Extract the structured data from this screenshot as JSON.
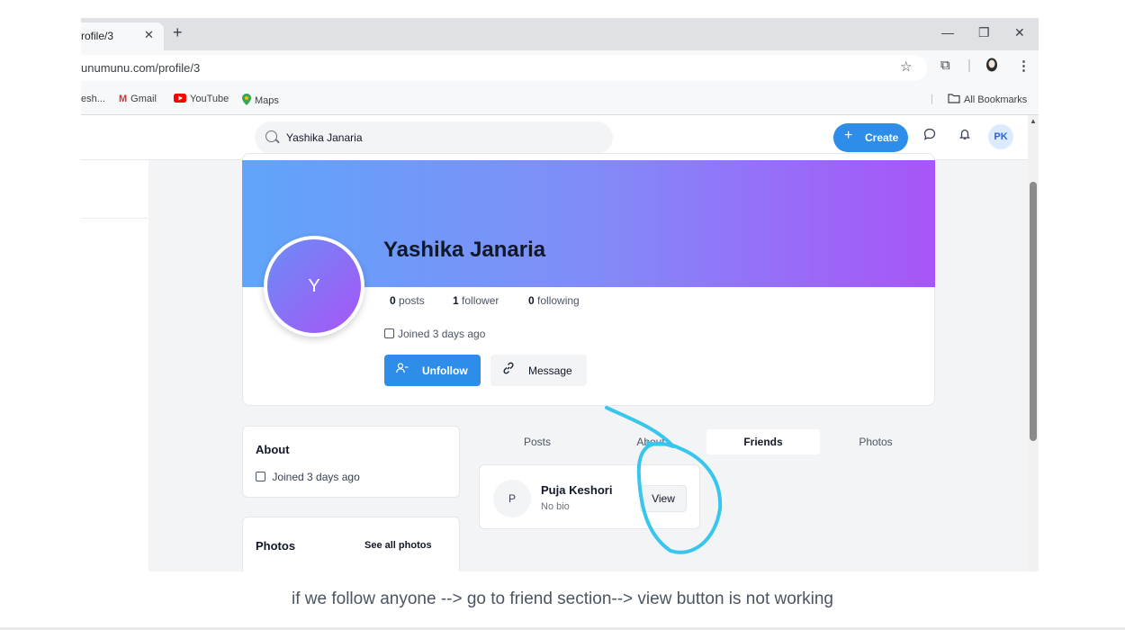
{
  "browser": {
    "tab_title": "rofile/3",
    "tab_close": "✕",
    "new_tab": "+",
    "url": "unumunu.com/profile/3",
    "star": "☆",
    "window_minimize": "—",
    "window_restore": "❐",
    "window_close": "✕",
    "bookmarks": [
      {
        "label": "esh...",
        "icon": ""
      },
      {
        "label": "Gmail",
        "icon": "gmail-icon"
      },
      {
        "label": "YouTube",
        "icon": "youtube-icon"
      },
      {
        "label": "Maps",
        "icon": "maps-icon"
      }
    ],
    "all_bookmarks": "All Bookmarks"
  },
  "header": {
    "search_value": "Yashika Janaria",
    "create_label": "Create",
    "avatar_initials": "PK"
  },
  "profile": {
    "avatar_initial": "Y",
    "name": "Yashika Janaria",
    "posts_count": "0",
    "posts_label": "posts",
    "followers_count": "1",
    "followers_label": "follower",
    "following_count": "0",
    "following_label": "following",
    "joined": "Joined 3 days ago",
    "unfollow_label": "Unfollow",
    "message_label": "Message"
  },
  "about": {
    "title": "About",
    "joined": "Joined 3 days ago"
  },
  "photos": {
    "title": "Photos",
    "see_all": "See all photos"
  },
  "tabs": [
    "Posts",
    "About",
    "Friends",
    "Photos"
  ],
  "active_tab": "Friends",
  "friend": {
    "initial": "P",
    "name": "Puja Keshori",
    "bio": "No bio",
    "view_label": "View"
  },
  "annotation_color": "#38c6ee",
  "caption": "if we follow anyone --> go to friend section--> view button is not working"
}
